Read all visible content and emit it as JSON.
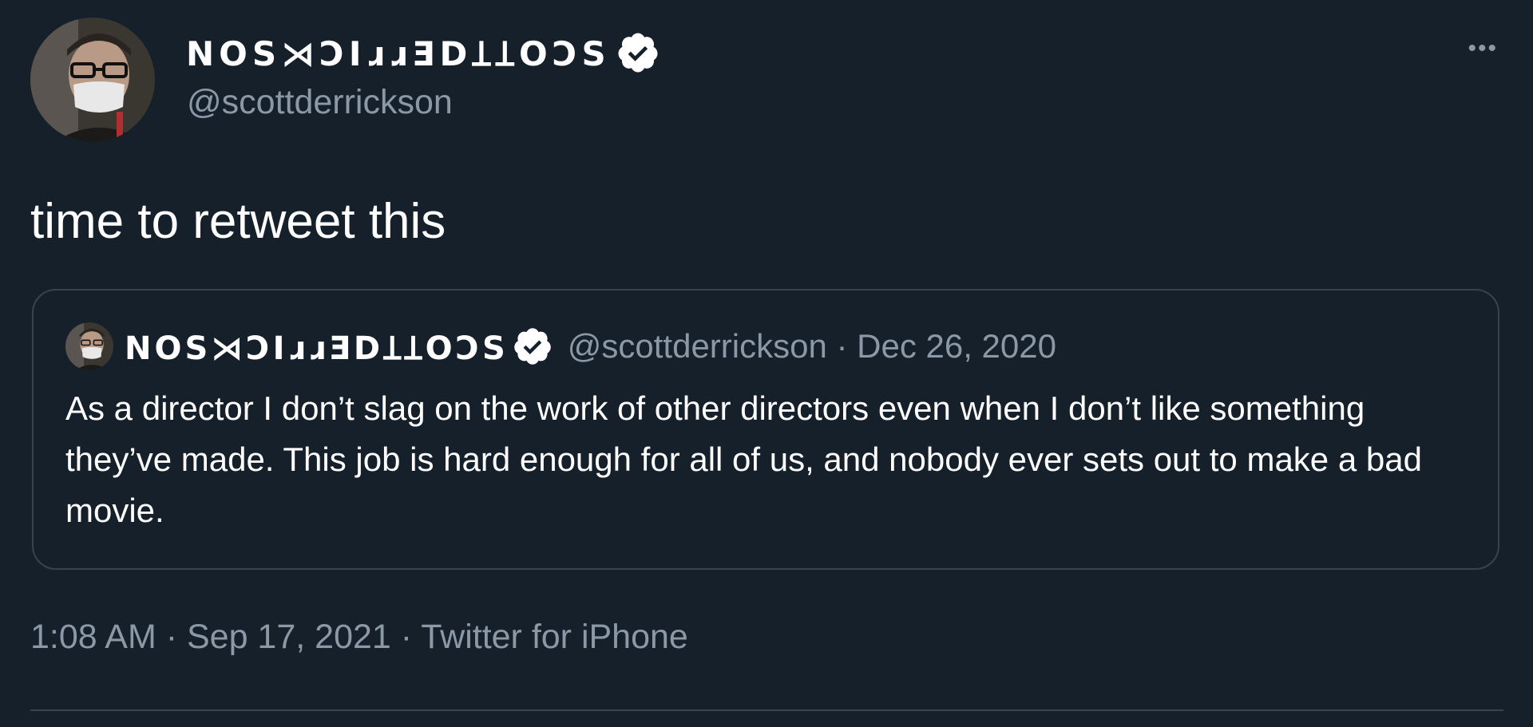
{
  "author": {
    "display_name": "NOS⋊ƆIɹɹƎDꞱꞱOƆS",
    "handle": "@scottderrickson",
    "avatar_icon": "profile-photo-masked-man",
    "verified_icon": "verified-badge-icon"
  },
  "tweet": {
    "text": "time to retweet this",
    "more_label": "•••",
    "timestamp": "1:08 AM · Sep 17, 2021 · Twitter for iPhone"
  },
  "quote": {
    "display_name": "NOS⋊ƆIɹɹƎDꞱꞱOƆS",
    "meta": "@scottderrickson · Dec 26, 2020",
    "text": "As a director I don’t slag on the work of other directors even when I don’t like something they’ve made. This job is hard enough for all of us, and nobody ever sets out to make a bad movie."
  },
  "colors": {
    "background": "#15202b",
    "secondary_text": "#8b98a5",
    "border": "#38444d",
    "text": "#ffffff"
  }
}
